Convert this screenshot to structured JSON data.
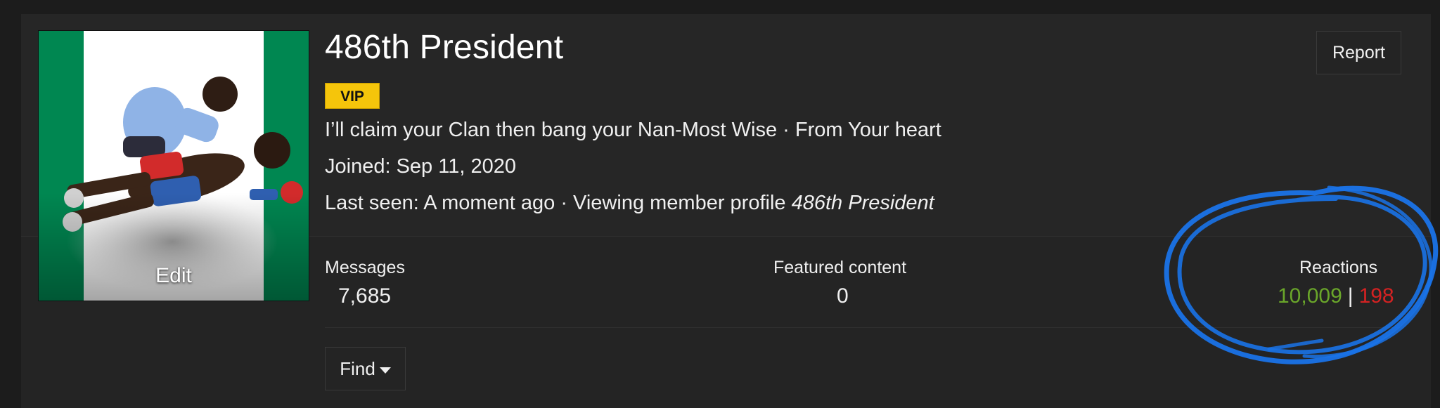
{
  "profile": {
    "name": "486th President",
    "badge": "VIP",
    "tagline": "I’ll claim your Clan then bang your Nan-Most Wise · From Your heart",
    "joined": "Joined: Sep 11, 2020",
    "last_seen_prefix": "Last seen: A moment ago · Viewing member profile ",
    "last_seen_member": "486th President",
    "avatar_edit_label": "Edit"
  },
  "actions": {
    "report_label": "Report",
    "find_label": "Find"
  },
  "stats": {
    "messages_label": "Messages",
    "messages_value": "7,685",
    "featured_label": "Featured content",
    "featured_value": "0",
    "reactions_label": "Reactions",
    "reactions_positive": "10,009",
    "reactions_separator": "|",
    "reactions_negative": "198"
  },
  "colors": {
    "badge_bg": "#f5c50b",
    "reactions_positive": "#6aa62a",
    "reactions_negative": "#d42222",
    "annotation": "#1a73e8",
    "flag_green": "#008751"
  },
  "icons": {
    "find_dropdown": "caret-down-icon"
  }
}
